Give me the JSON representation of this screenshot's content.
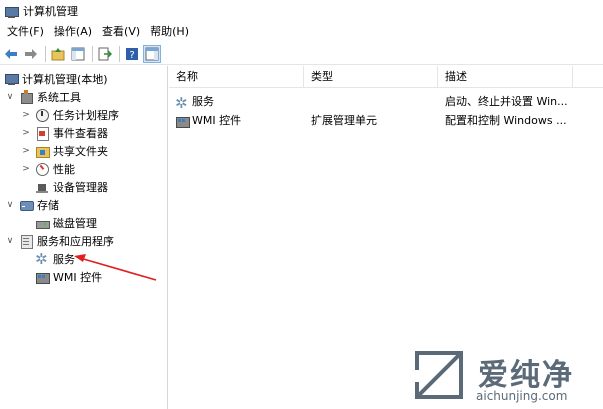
{
  "window": {
    "title": "计算机管理"
  },
  "menubar": {
    "items": [
      "文件(F)",
      "操作(A)",
      "查看(V)",
      "帮助(H)"
    ]
  },
  "toolbar": {
    "buttons": [
      "back-icon",
      "forward-icon",
      "up-folder-icon",
      "show-hide-tree-icon",
      "export-icon",
      "help-icon",
      "show-hide-action-pane-icon"
    ]
  },
  "tree": {
    "root": "计算机管理(本地)",
    "system_tools": "系统工具",
    "task_scheduler": "任务计划程序",
    "event_viewer": "事件查看器",
    "shared_folders": "共享文件夹",
    "performance": "性能",
    "device_manager": "设备管理器",
    "storage": "存储",
    "disk_management": "磁盘管理",
    "services_apps": "服务和应用程序",
    "services": "服务",
    "wmi": "WMI 控件"
  },
  "list": {
    "columns": [
      "名称",
      "类型",
      "描述"
    ],
    "rows": [
      {
        "name": "服务",
        "type": "",
        "description": "启动、终止并设置 Win..."
      },
      {
        "name": "WMI 控件",
        "type": "扩展管理单元",
        "description": "配置和控制 Windows ..."
      }
    ]
  },
  "annotation": {
    "color": "#e02020"
  },
  "watermark": {
    "brand": "爱纯净",
    "url": "aichunjing.com",
    "color": "#5a6a78"
  },
  "colors": {
    "selection": "#cfe5f9",
    "accent": "#3a7fc4"
  }
}
